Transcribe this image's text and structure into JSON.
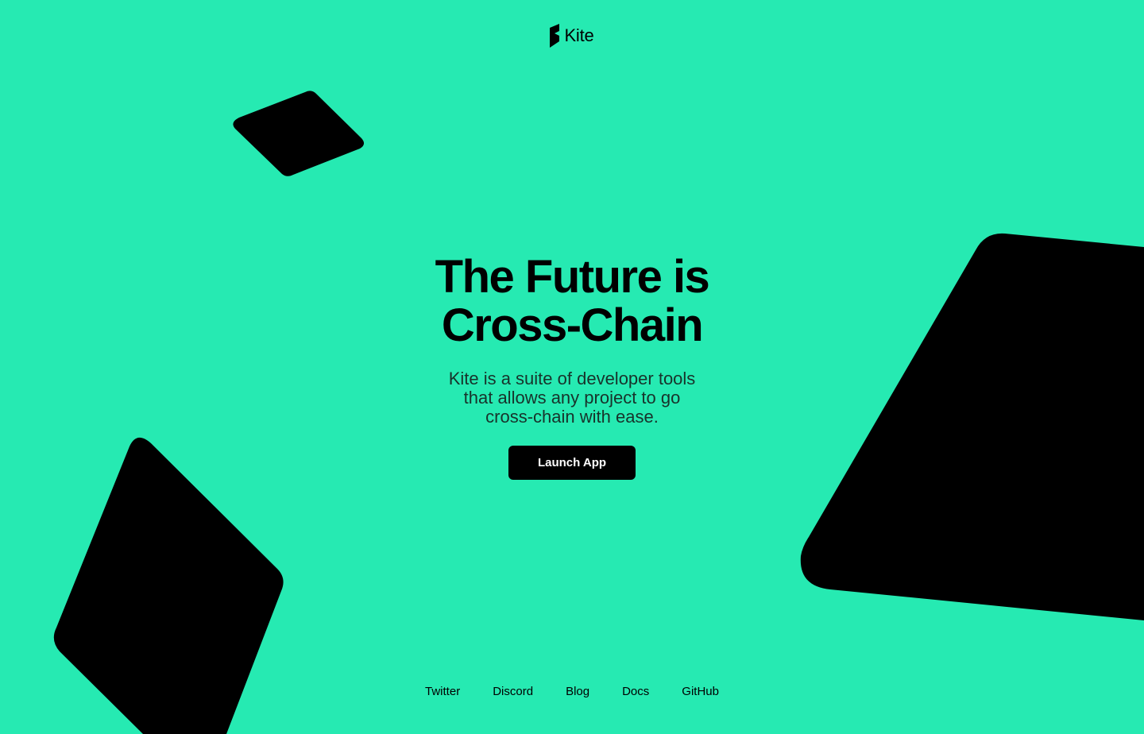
{
  "header": {
    "logo_text": "Kite",
    "logo_icon": "kite-logo-icon"
  },
  "hero": {
    "headline_line1": "The Future is",
    "headline_line2": "Cross-Chain",
    "subtitle": "Kite is a suite of developer tools that allows any project to go cross-chain with ease.",
    "cta_label": "Launch App"
  },
  "footer": {
    "links": [
      "Twitter",
      "Discord",
      "Blog",
      "Docs",
      "GitHub"
    ]
  },
  "colors": {
    "background": "#26EAB2",
    "shape": "#000000",
    "button_bg": "#000000",
    "button_text": "#FFFFFF"
  }
}
